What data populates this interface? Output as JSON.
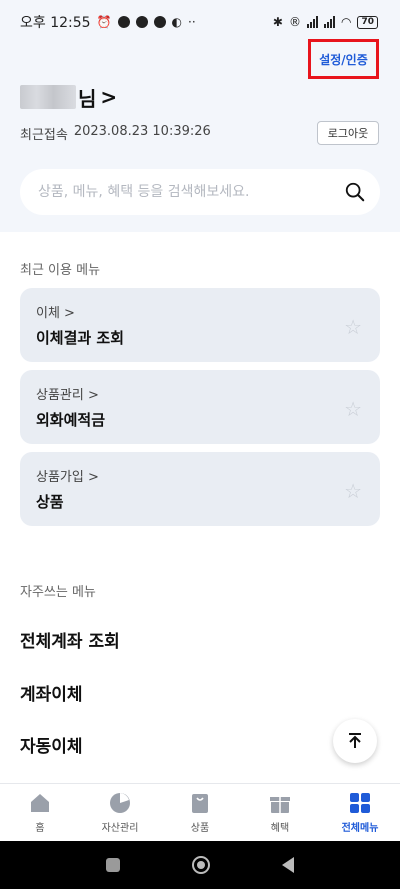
{
  "status_bar": {
    "time": "오후 12:55",
    "battery": "70"
  },
  "header": {
    "settings_link": "설정/인증",
    "honorific": "님",
    "chevron": ">",
    "last_login_label": "최근접속",
    "last_login_time": "2023.08.23 10:39:26",
    "logout_label": "로그아웃"
  },
  "search": {
    "placeholder": "상품, 메뉴, 혜택 등을 검색해보세요."
  },
  "recent_menu": {
    "title": "최근 이용 메뉴",
    "items": [
      {
        "category": "이체 >",
        "name": "이체결과 조회"
      },
      {
        "category": "상품관리 >",
        "name": "외화예적금"
      },
      {
        "category": "상품가입 >",
        "name": "상품"
      }
    ]
  },
  "frequent_menu": {
    "title": "자주쓰는 메뉴",
    "items": [
      "전체계좌 조회",
      "계좌이체",
      "자동이체"
    ]
  },
  "bottom_nav": {
    "items": [
      {
        "label": "홈",
        "icon": "home-icon"
      },
      {
        "label": "자산관리",
        "icon": "pie-chart-icon"
      },
      {
        "label": "상품",
        "icon": "shopping-bag-icon"
      },
      {
        "label": "혜택",
        "icon": "gift-icon"
      },
      {
        "label": "전체메뉴",
        "icon": "grid-menu-icon"
      }
    ],
    "active_color": "#1f5bd8",
    "inactive_color": "#9aa0aa"
  },
  "colors": {
    "highlight_box": "#e8141c",
    "accent": "#1f5bd8",
    "header_bg": "#f3f6fb",
    "card_bg": "#e9edf3"
  }
}
